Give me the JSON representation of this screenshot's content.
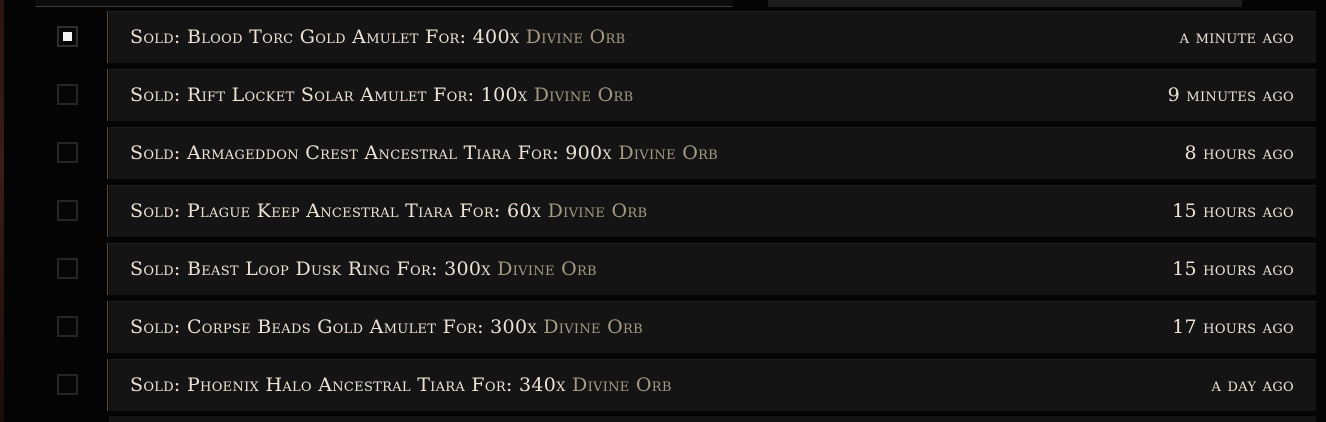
{
  "rows": [
    {
      "checked": true,
      "text": "Sold: Blood Torc Gold Amulet For: 400x ",
      "currency": "Divine Orb",
      "time": "a minute ago"
    },
    {
      "checked": false,
      "text": "Sold: Rift Locket Solar Amulet For: 100x ",
      "currency": "Divine Orb",
      "time": "9 minutes ago"
    },
    {
      "checked": false,
      "text": "Sold: Armageddon Crest Ancestral Tiara For: 900x ",
      "currency": "Divine Orb",
      "time": "8 hours ago"
    },
    {
      "checked": false,
      "text": "Sold: Plague Keep Ancestral Tiara For: 60x ",
      "currency": "Divine Orb",
      "time": "15 hours ago"
    },
    {
      "checked": false,
      "text": "Sold: Beast Loop Dusk Ring For: 300x ",
      "currency": "Divine Orb",
      "time": "15 hours ago"
    },
    {
      "checked": false,
      "text": "Sold: Corpse Beads Gold Amulet For: 300x ",
      "currency": "Divine Orb",
      "time": "17 hours ago"
    },
    {
      "checked": false,
      "text": "Sold: Phoenix Halo Ancestral Tiara For: 340x ",
      "currency": "Divine Orb",
      "time": "a day ago"
    }
  ],
  "colors": {
    "text": "#ece3d5",
    "currency": "#a59a83",
    "row_background": "#141414",
    "divider": "#5e4a2e"
  }
}
